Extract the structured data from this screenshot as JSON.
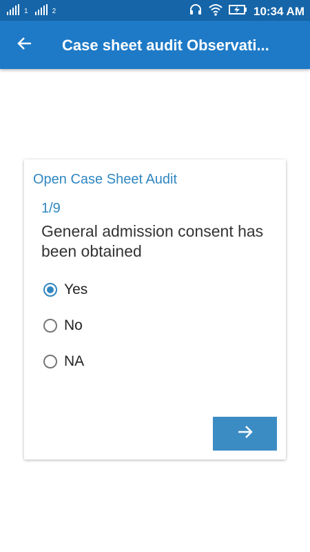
{
  "status_bar": {
    "sim1_label": "1",
    "sim2_label": "2",
    "time": "10:34 AM"
  },
  "app_bar": {
    "title": "Case sheet audit Observati..."
  },
  "card": {
    "title": "Open Case Sheet Audit",
    "counter": "1/9",
    "question": "General admission consent has been obtained",
    "options": [
      {
        "label": "Yes",
        "selected": true
      },
      {
        "label": "No",
        "selected": false
      },
      {
        "label": "NA",
        "selected": false
      }
    ]
  },
  "colors": {
    "status_bar": "#1565a8",
    "app_bar": "#1e7ac7",
    "accent": "#2e86c1",
    "next_button": "#3c8cc4"
  },
  "icons": {
    "back": "arrow-left-icon",
    "next": "arrow-right-icon",
    "headset": "headset-icon",
    "wifi": "wifi-icon",
    "battery": "battery-charging-icon"
  }
}
